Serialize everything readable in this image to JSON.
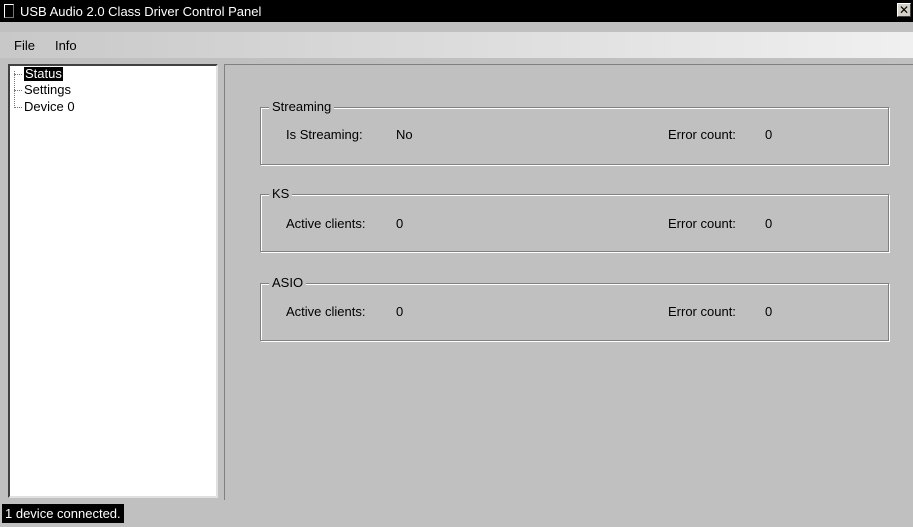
{
  "window": {
    "title": "USB Audio 2.0 Class Driver Control Panel",
    "close_glyph": "✕"
  },
  "menu": {
    "items": [
      "File",
      "Info"
    ]
  },
  "tree": {
    "items": [
      "Status",
      "Settings",
      "Device 0"
    ],
    "selected": "Status"
  },
  "groups": {
    "streaming": {
      "title": "Streaming",
      "left_label": "Is Streaming:",
      "left_value": "No",
      "right_label": "Error count:",
      "right_value": "0"
    },
    "ks": {
      "title": "KS",
      "left_label": "Active clients:",
      "left_value": "0",
      "right_label": "Error count:",
      "right_value": "0"
    },
    "asio": {
      "title": "ASIO",
      "left_label": "Active clients:",
      "left_value": "0",
      "right_label": "Error count:",
      "right_value": "0"
    }
  },
  "status": {
    "text": "1 device connected."
  }
}
